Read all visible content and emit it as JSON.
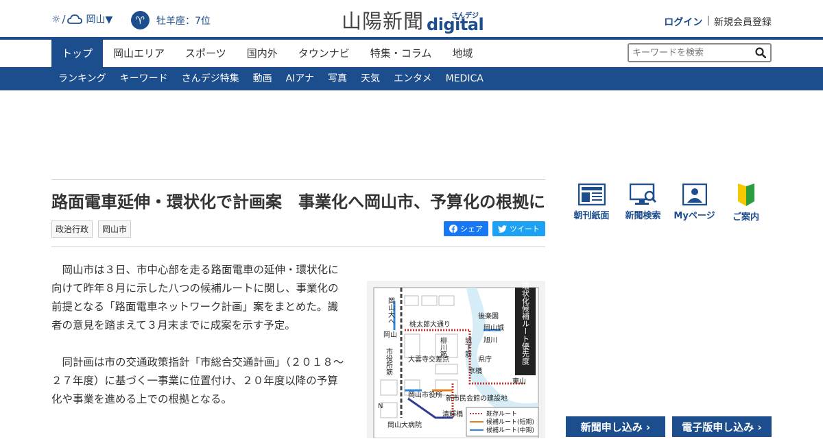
{
  "header": {
    "weather_city": "岡山▼",
    "horoscope": "牡羊座：7位",
    "logo_kanji": "山陽新聞",
    "logo_sandeji": "さんデジ",
    "logo_digital": "digital",
    "login": "ログイン",
    "separator": "|",
    "register": "新規会員登録"
  },
  "mainnav": {
    "items": [
      {
        "label": "トップ",
        "active": true
      },
      {
        "label": "岡山エリア"
      },
      {
        "label": "スポーツ"
      },
      {
        "label": "国内外"
      },
      {
        "label": "タウンナビ"
      },
      {
        "label": "特集・コラム"
      },
      {
        "label": "地域"
      }
    ],
    "search_placeholder": "キーワードを検索"
  },
  "subnav": {
    "items": [
      "ランキング",
      "キーワード",
      "さんデジ特集",
      "動画",
      "AIアナ",
      "写真",
      "天気",
      "エンタメ",
      "MEDICA"
    ]
  },
  "article": {
    "title": "路面電車延伸・環状化で計画案　事業化へ岡山市、予算化の根拠に",
    "tags": [
      "政治行政",
      "岡山市"
    ],
    "share_fb": "シェア",
    "share_tw": "ツイート",
    "paragraphs": [
      "岡山市は３日、市中心部を走る路面電車の延伸・環状化に向けて昨年８月に示した八つの候補ルートに関し、事業化の前提となる「路面電車ネットワーク計画」案をまとめた。識者の意見を踏まえて３月末までに成案を示す予定。",
      "同計画は市の交通政策指針「市総合交通計画」（２０１８～２７年度）に基づく一事業に位置付け、２０年度以降の予算化や事業を進める上での根拠となる。"
    ]
  },
  "map": {
    "title": "路面電車の延伸環状化候補ルート優先度",
    "labels": [
      "岡山大へ",
      "桃太郎大通り",
      "後楽園",
      "岡山城",
      "旭川",
      "岡山",
      "市役所筋",
      "柳川筋",
      "城下筋",
      "県庁",
      "大雲寺交差点",
      "京橋",
      "東山",
      "岡山市役所",
      "新市民会館の建設地",
      "清輝橋",
      "岡山大病院",
      "N"
    ],
    "legend": [
      "既存ルート",
      "候補ルート(短期)",
      "候補ルート(中期)"
    ],
    "colors": {
      "existing": "#c0392b",
      "short": "#e67e22",
      "mid": "#2e86de"
    }
  },
  "sidebar": {
    "icons": [
      {
        "label": "朝刊紙面",
        "icon": "newspaper-icon"
      },
      {
        "label": "新聞検索",
        "icon": "monitor-search-icon"
      },
      {
        "label": "Myページ",
        "icon": "user-page-icon"
      },
      {
        "label": "ご案内",
        "icon": "beginner-mark-icon"
      }
    ],
    "cta_paper": "新聞申し込み ›",
    "cta_digital": "電子版申し込み ›"
  },
  "colors": {
    "brand": "#1c4d8c"
  }
}
